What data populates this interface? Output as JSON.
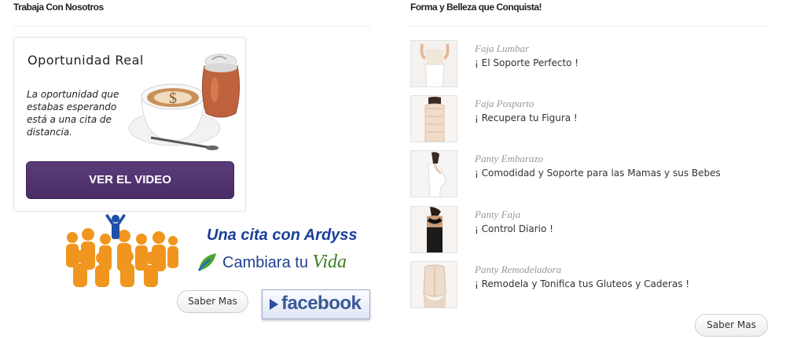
{
  "left": {
    "heading": "Trabaja Con Nosotros",
    "promo": {
      "title": "Oportunidad Real",
      "text": "La oportunidad que estabas esperando está a una cita de distancia.",
      "video_button": "VER EL VIDEO",
      "coin_symbol": "$"
    },
    "ardyss": {
      "line1": "Una cita con Ardyss",
      "line2": "Cambiara tu ",
      "line2_emphasis": "Vida"
    },
    "saber_mas": "Saber Mas",
    "facebook": "facebook"
  },
  "right": {
    "heading": "Forma y Belleza que Conquista!",
    "products": [
      {
        "name": "Faja Lumbar",
        "desc": "¡ El Soporte Perfecto !"
      },
      {
        "name": "Faja Posparto",
        "desc": "¡ Recupera tu Figura !"
      },
      {
        "name": "Panty Embarazo",
        "desc": "¡ Comodidad y Soporte para las Mamas y sus Bebes"
      },
      {
        "name": "Panty Faja",
        "desc": "¡ Control Diario !"
      },
      {
        "name": "Panty Remodeladora",
        "desc": "¡ Remodela y Tonifica tus Gluteos y Caderas !"
      }
    ],
    "saber_mas": "Saber Mas"
  },
  "colors": {
    "video_button": "#4a2d66",
    "ardyss_blue": "#1a3f9c",
    "ardyss_green": "#3a7d1f",
    "facebook_blue": "#3b5998",
    "people_orange": "#f0961e"
  }
}
